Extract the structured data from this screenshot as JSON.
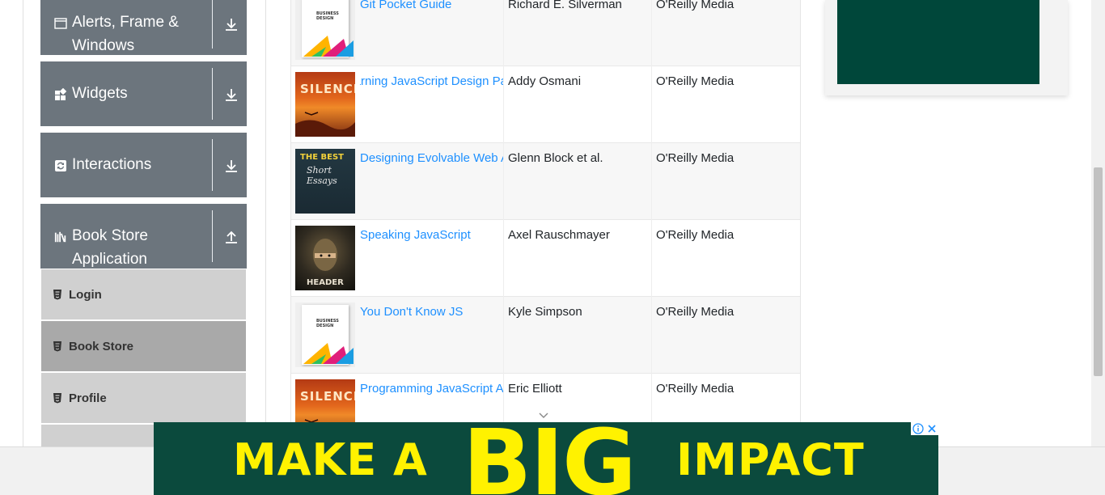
{
  "sidebar": {
    "groups": [
      {
        "label_line1": "Alerts, Frame &",
        "label_line2": "Windows",
        "icon": "window-icon",
        "arrow": "download-arrow-icon"
      },
      {
        "label": "Widgets",
        "icon": "widgets-grid-icon",
        "arrow": "download-arrow-icon"
      },
      {
        "label": "Interactions",
        "icon": "interactions-icon",
        "arrow": "download-arrow-icon"
      },
      {
        "label_line1": "Book Store",
        "label_line2": "Application",
        "icon": "books-icon",
        "arrow": "upload-arrow-icon"
      }
    ],
    "items": [
      {
        "label": "Login",
        "icon": "html5-icon"
      },
      {
        "label": "Book Store",
        "icon": "html5-icon",
        "active": true
      },
      {
        "label": "Profile",
        "icon": "html5-icon"
      }
    ]
  },
  "books": [
    {
      "title": "Git Pocket Guide",
      "author": "Richard E. Silverman",
      "publisher": "O'Reilly Media",
      "cover": "business-design"
    },
    {
      "title": "Learning JavaScript Design Patterns",
      "author": "Addy Osmani",
      "publisher": "O'Reilly Media",
      "cover": "silence"
    },
    {
      "title": "Designing Evolvable Web APIs with ASP.NET",
      "author": "Glenn Block et al.",
      "publisher": "O'Reilly Media",
      "cover": "the-best"
    },
    {
      "title": "Speaking JavaScript",
      "author": "Axel Rauschmayer",
      "publisher": "O'Reilly Media",
      "cover": "header"
    },
    {
      "title": "You Don't Know JS",
      "author": "Kyle Simpson",
      "publisher": "O'Reilly Media",
      "cover": "business-design"
    },
    {
      "title": "Programming JavaScript Applications",
      "author": "Eric Elliott",
      "publisher": "O'Reilly Media",
      "cover": "silence"
    }
  ],
  "covers": {
    "business_text": "BUSINESS DESIGN",
    "silence_text": "SILENCE",
    "best_text": "THE BEST",
    "best_text2": "Short Essays",
    "header_text": "HEADER"
  },
  "banner": {
    "part1": "MAKE A",
    "part2": "BIG",
    "part3": "IMPACT",
    "bg_color": "#0b4a3d",
    "text_color": "#fff200"
  },
  "colors": {
    "sidebar_header": "#6c757d",
    "menu_item": "#d0d0d0",
    "menu_item_active": "#a9a9a9",
    "link": "#1e90ff"
  }
}
